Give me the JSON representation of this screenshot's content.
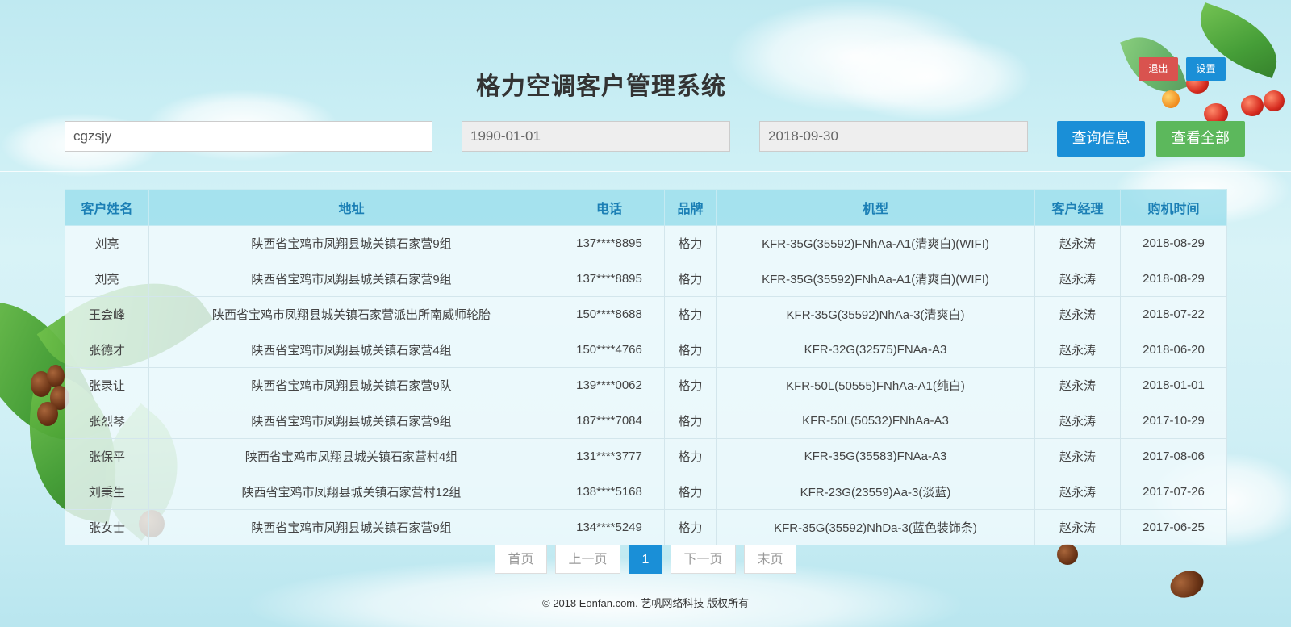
{
  "header": {
    "title": "格力空调客户管理系统",
    "logout_label": "退出",
    "settings_label": "设置"
  },
  "search": {
    "keyword_value": "cgzsjy",
    "start_date": "1990-01-01",
    "end_date": "2018-09-30",
    "query_label": "查询信息",
    "view_all_label": "查看全部"
  },
  "table": {
    "columns": [
      "客户姓名",
      "地址",
      "电话",
      "品牌",
      "机型",
      "客户经理",
      "购机时间"
    ],
    "rows": [
      [
        "刘亮",
        "陕西省宝鸡市凤翔县城关镇石家营9组",
        "137****8895",
        "格力",
        "KFR-35G(35592)FNhAa-A1(清爽白)(WIFI)",
        "赵永涛",
        "2018-08-29"
      ],
      [
        "刘亮",
        "陕西省宝鸡市凤翔县城关镇石家营9组",
        "137****8895",
        "格力",
        "KFR-35G(35592)FNhAa-A1(清爽白)(WIFI)",
        "赵永涛",
        "2018-08-29"
      ],
      [
        "王会峰",
        "陕西省宝鸡市凤翔县城关镇石家营派出所南威师轮胎",
        "150****8688",
        "格力",
        "KFR-35G(35592)NhAa-3(清爽白)",
        "赵永涛",
        "2018-07-22"
      ],
      [
        "张德才",
        "陕西省宝鸡市凤翔县城关镇石家营4组",
        "150****4766",
        "格力",
        "KFR-32G(32575)FNAa-A3",
        "赵永涛",
        "2018-06-20"
      ],
      [
        "张录让",
        "陕西省宝鸡市凤翔县城关镇石家营9队",
        "139****0062",
        "格力",
        "KFR-50L(50555)FNhAa-A1(纯白)",
        "赵永涛",
        "2018-01-01"
      ],
      [
        "张烈琴",
        "陕西省宝鸡市凤翔县城关镇石家营9组",
        "187****7084",
        "格力",
        "KFR-50L(50532)FNhAa-A3",
        "赵永涛",
        "2017-10-29"
      ],
      [
        "张保平",
        "陕西省宝鸡市凤翔县城关镇石家营村4组",
        "131****3777",
        "格力",
        "KFR-35G(35583)FNAa-A3",
        "赵永涛",
        "2017-08-06"
      ],
      [
        "刘秉生",
        "陕西省宝鸡市凤翔县城关镇石家营村12组",
        "138****5168",
        "格力",
        "KFR-23G(23559)Aa-3(淡蓝)",
        "赵永涛",
        "2017-07-26"
      ],
      [
        "张女士",
        "陕西省宝鸡市凤翔县城关镇石家营9组",
        "134****5249",
        "格力",
        "KFR-35G(35592)NhDa-3(蓝色装饰条)",
        "赵永涛",
        "2017-06-25"
      ]
    ]
  },
  "pagination": {
    "first": "首页",
    "prev": "上一页",
    "current": "1",
    "next": "下一页",
    "last": "末页"
  },
  "footer": {
    "text": "© 2018 Eonfan.com. 艺帆网络科技 版权所有"
  },
  "colors": {
    "primary": "#1a8fd7",
    "success": "#5cb85c",
    "danger": "#d9534f",
    "header_text": "#1b7fb5"
  }
}
